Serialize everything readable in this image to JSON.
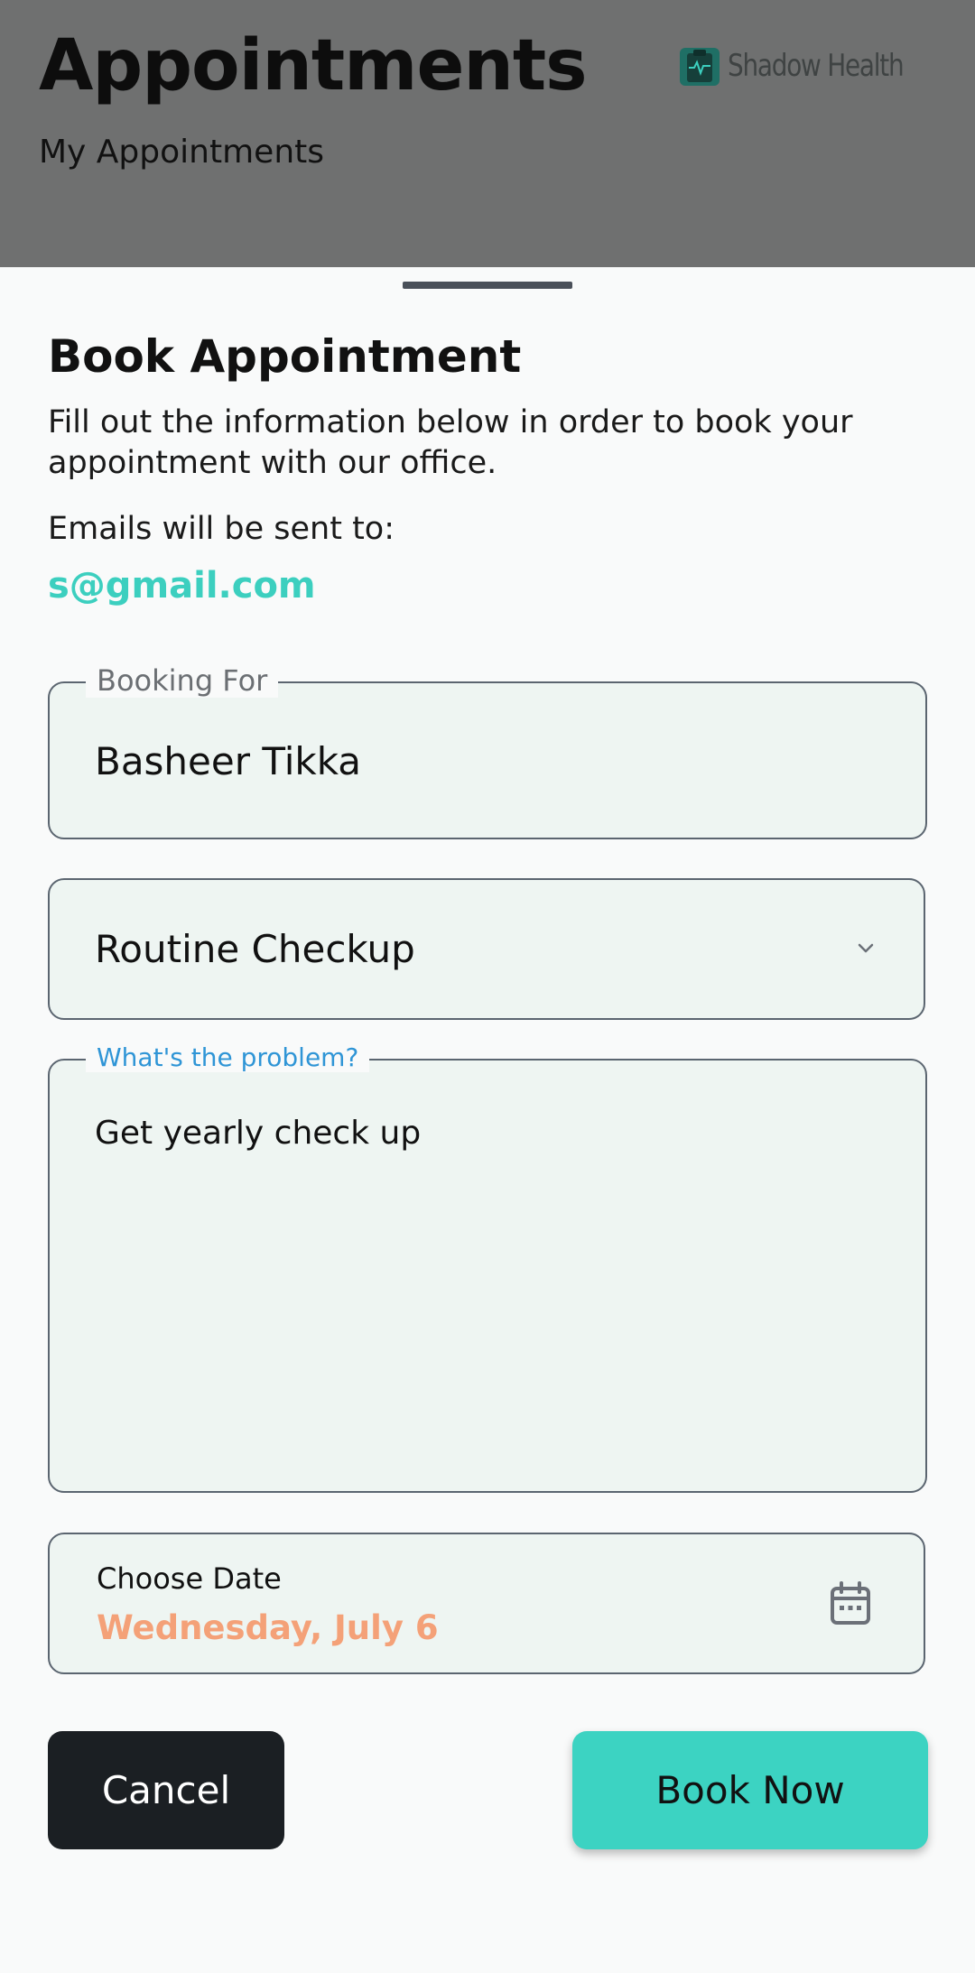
{
  "background_page": {
    "title": "Appointments",
    "subtitle": "My Appointments",
    "brand_name": "Shadow Health"
  },
  "sheet": {
    "title": "Book Appointment",
    "description": "Fill out the information below in order to book your appointment with our office.",
    "email_label": "Emails will be sent to:",
    "email": "s@gmail.com"
  },
  "form": {
    "booking_for": {
      "label": "Booking For",
      "value": "Basheer Tikka"
    },
    "appointment_type": {
      "selected": "Routine Checkup"
    },
    "problem": {
      "label": "What's the problem?",
      "value": "Get yearly check up"
    },
    "date": {
      "label": "Choose Date",
      "value": "Wednesday, July 6"
    }
  },
  "actions": {
    "cancel_label": "Cancel",
    "book_label": "Book Now"
  },
  "colors": {
    "accent_teal": "#3cd3c2",
    "date_orange": "#f4a178",
    "focus_blue": "#2f95d6",
    "dark_button": "#1b1f23"
  },
  "icons": {
    "brand_logo": "clipboard-pulse-icon",
    "dropdown": "chevron-down-icon",
    "date_picker": "calendar-icon"
  }
}
